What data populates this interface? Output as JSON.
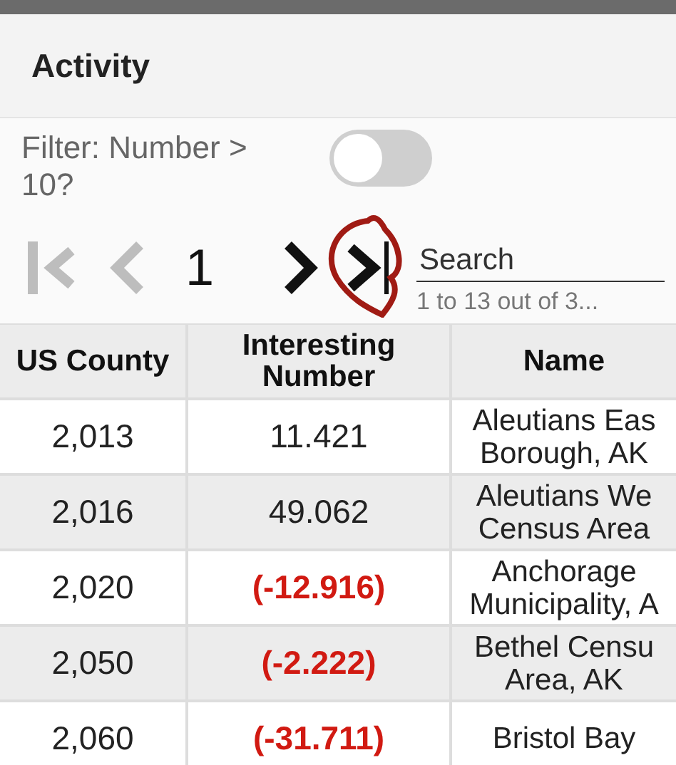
{
  "header": {
    "title": "Activity"
  },
  "filter": {
    "label": "Filter: Number > 10?",
    "on": false
  },
  "pager": {
    "first_disabled": true,
    "prev_disabled": true,
    "page": "1",
    "next_disabled": false,
    "last_disabled": false
  },
  "search": {
    "placeholder": "Search",
    "count": "1 to 13 out of 3..."
  },
  "table": {
    "columns": [
      "US County",
      "Interesting Number",
      "Name"
    ],
    "rows": [
      {
        "county": "2,013",
        "number": "11.421",
        "negative": false,
        "name": [
          "Aleutians Eas",
          "Borough, AK"
        ]
      },
      {
        "county": "2,016",
        "number": "49.062",
        "negative": false,
        "name": [
          "Aleutians We",
          "Census Area"
        ]
      },
      {
        "county": "2,020",
        "number": "(-12.916)",
        "negative": true,
        "name": [
          "Anchorage",
          "Municipality, A"
        ]
      },
      {
        "county": "2,050",
        "number": "(-2.222)",
        "negative": true,
        "name": [
          "Bethel Censu",
          "Area, AK"
        ]
      },
      {
        "county": "2,060",
        "number": "(-31.711)",
        "negative": true,
        "name": [
          "Bristol Bay"
        ]
      }
    ]
  }
}
